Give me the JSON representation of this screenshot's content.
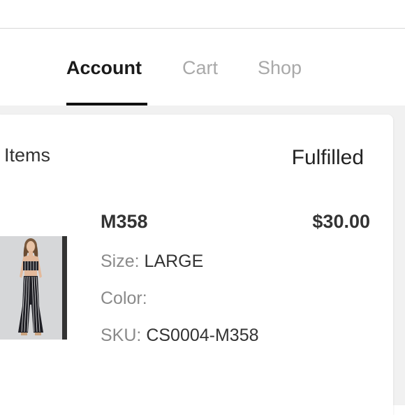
{
  "tabs": [
    {
      "label": "Account",
      "active": true
    },
    {
      "label": "Cart",
      "active": false
    },
    {
      "label": "Shop",
      "active": false
    }
  ],
  "order": {
    "items_heading": "Items",
    "status": "Fulfilled",
    "item": {
      "name": "M358",
      "price": "$30.00",
      "size_label": "Size:",
      "size_value": "LARGE",
      "color_label": "Color:",
      "color_value": "",
      "sku_label": "SKU:",
      "sku_value": "CS0004-M358",
      "image_icon": "striped-outfit-photo"
    }
  },
  "colors": {
    "background_grey": "#f1f1f1",
    "tab_active": "#1a1a1a",
    "tab_inactive": "#a9a9a9",
    "label_grey": "#8a8a8a"
  }
}
